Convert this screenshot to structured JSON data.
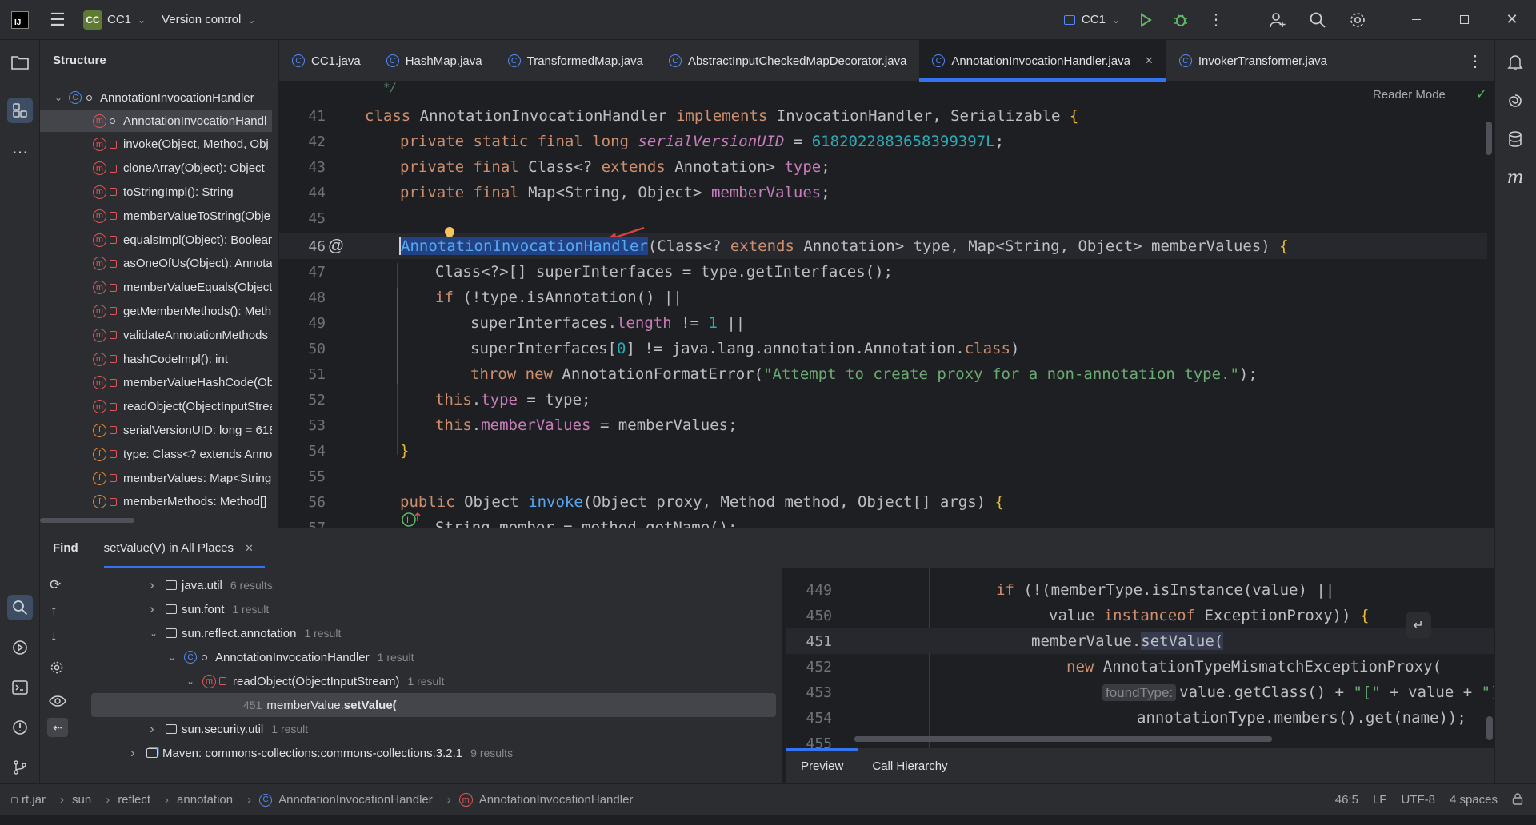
{
  "titlebar": {
    "project_badge": "CC",
    "project_name": "CC1",
    "vcs": "Version control",
    "run_config": "CC1"
  },
  "structure": {
    "title": "Structure",
    "root": "AnnotationInvocationHandler",
    "items": [
      {
        "label": "AnnotationInvocationHandl",
        "type": "m",
        "selected": true
      },
      {
        "label": "invoke(Object, Method, Obj",
        "type": "m"
      },
      {
        "label": "cloneArray(Object): Object",
        "type": "m"
      },
      {
        "label": "toStringImpl(): String",
        "type": "m"
      },
      {
        "label": "memberValueToString(Obje",
        "type": "m"
      },
      {
        "label": "equalsImpl(Object): Boolean",
        "type": "m"
      },
      {
        "label": "asOneOfUs(Object): Annotat",
        "type": "m"
      },
      {
        "label": "memberValueEquals(Object,",
        "type": "m"
      },
      {
        "label": "getMemberMethods(): Meth",
        "type": "m"
      },
      {
        "label": "validateAnnotationMethods",
        "type": "m"
      },
      {
        "label": "hashCodeImpl(): int",
        "type": "m"
      },
      {
        "label": "memberValueHashCode(Ob",
        "type": "m"
      },
      {
        "label": "readObject(ObjectInputStrea",
        "type": "m"
      },
      {
        "label": "serialVersionUID: long = 618",
        "type": "f"
      },
      {
        "label": "type: Class<? extends Annot",
        "type": "f"
      },
      {
        "label": "memberValues: Map<String,",
        "type": "f"
      },
      {
        "label": "memberMethods: Method[]",
        "type": "f"
      }
    ]
  },
  "tabs": [
    {
      "label": "CC1.java"
    },
    {
      "label": "HashMap.java"
    },
    {
      "label": "TransformedMap.java"
    },
    {
      "label": "AbstractInputCheckedMapDecorator.java"
    },
    {
      "label": "AnnotationInvocationHandler.java",
      "active": true
    },
    {
      "label": "InvokerTransformer.java"
    }
  ],
  "editor": {
    "reader_mode": "Reader Mode",
    "lines": [
      "41",
      "42",
      "43",
      "44",
      "45",
      "46",
      "47",
      "48",
      "49",
      "50",
      "51",
      "52",
      "53",
      "54",
      "55",
      "56",
      "57"
    ],
    "code": {
      "l41_a": "class ",
      "l41_b": "AnnotationInvocationHandler ",
      "l41_c": "implements ",
      "l41_d": "InvocationHandler, Serializable ",
      "l41_e": "{",
      "l42_a": "private static final long ",
      "l42_b": "serialVersionUID",
      "l42_c": " = ",
      "l42_d": "6182022883658399397L",
      "l42_e": ";",
      "l43_a": "private final ",
      "l43_b": "Class<? ",
      "l43_c": "extends ",
      "l43_d": "Annotation> ",
      "l43_e": "type",
      "l43_f": ";",
      "l44_a": "private final ",
      "l44_b": "Map<String, Object> ",
      "l44_c": "memberValues",
      "l44_d": ";",
      "l46_a": "AnnotationInvocationHandler",
      "l46_b": "(Class<? ",
      "l46_c": "extends ",
      "l46_d": "Annotation> type, Map<String, Object> memberValues) ",
      "l46_e": "{",
      "l47": "Class<?>[] superInterfaces = type.getInterfaces();",
      "l48_a": "if ",
      "l48_b": "(!type.isAnnotation() ||",
      "l49_a": "superInterfaces.",
      "l49_b": "length",
      "l49_c": " != ",
      "l49_d": "1",
      "l49_e": " ||",
      "l50_a": "superInterfaces[",
      "l50_b": "0",
      "l50_c": "] != java.lang.annotation.Annotation.",
      "l50_d": "class",
      "l50_e": ")",
      "l51_a": "throw new ",
      "l51_b": "AnnotationFormatError(",
      "l51_c": "\"Attempt to create proxy for a non-annotation type.\"",
      "l51_d": ");",
      "l52_a": "this",
      "l52_b": ".",
      "l52_c": "type",
      "l52_d": " = type;",
      "l53_a": "this",
      "l53_b": ".",
      "l53_c": "memberValues",
      "l53_d": " = memberValues;",
      "l54": "}",
      "l56_a": "public ",
      "l56_b": "Object ",
      "l56_c": "invoke",
      "l56_d": "(Object proxy, Method method, Object[] args) ",
      "l56_e": "{",
      "l57": "String member = method.getName();"
    }
  },
  "find": {
    "title": "Find",
    "tab": "setValue(V) in All Places",
    "tree": [
      {
        "label": "java.util",
        "count": "6 results"
      },
      {
        "label": "sun.font",
        "count": "1 result"
      },
      {
        "label": "sun.reflect.annotation",
        "count": "1 result"
      },
      {
        "label": "AnnotationInvocationHandler",
        "count": "1 result"
      },
      {
        "label": "readObject(ObjectInputStream)",
        "count": "1 result"
      },
      {
        "line": "451",
        "pre": "memberValue.",
        "match": "setValue("
      },
      {
        "label": "sun.security.util",
        "count": "1 result"
      },
      {
        "label": "Maven: commons-collections:commons-collections:3.2.1",
        "count": "9 results"
      }
    ],
    "preview_tab": "Preview",
    "hierarchy_tab": "Call Hierarchy"
  },
  "preview": {
    "lines": [
      "449",
      "450",
      "451",
      "452",
      "453",
      "454",
      "455"
    ],
    "code": {
      "p449_a": "if ",
      "p449_b": "(!(memberType.isInstance(value) ||",
      "p450_a": "value ",
      "p450_b": "instanceof ",
      "p450_c": "ExceptionProxy)) ",
      "p450_d": "{",
      "p451_a": "memberValue.",
      "p451_b": "setValue(",
      "p452_a": "new ",
      "p452_b": "AnnotationTypeMismatchExceptionProxy(",
      "p453_hint": "foundType:",
      "p453_a": "value.getClass() + ",
      "p453_b": "\"[\"",
      "p453_c": " + value + ",
      "p453_d": "\"]",
      "p454": "annotationType.members().get(name));"
    }
  },
  "statusbar": {
    "crumbs": [
      "rt.jar",
      "sun",
      "reflect",
      "annotation",
      "AnnotationInvocationHandler",
      "AnnotationInvocationHandler"
    ],
    "position": "46:5",
    "line_sep": "LF",
    "encoding": "UTF-8",
    "indent": "4 spaces"
  }
}
